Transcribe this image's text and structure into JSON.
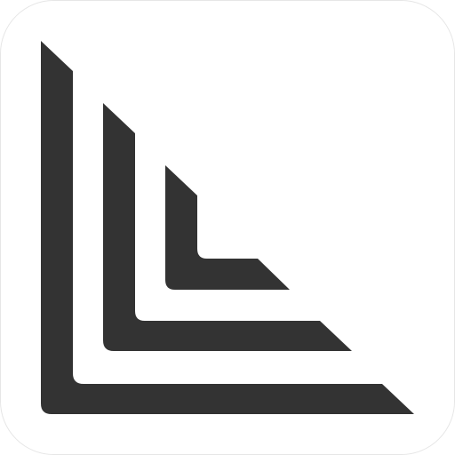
{
  "icon": {
    "name": "nested-corner-brackets-logo",
    "tile_color": "#ffffff",
    "tile_border_color": "#e6e6e6",
    "mark_color": "#333333",
    "bracket_count": 3
  }
}
